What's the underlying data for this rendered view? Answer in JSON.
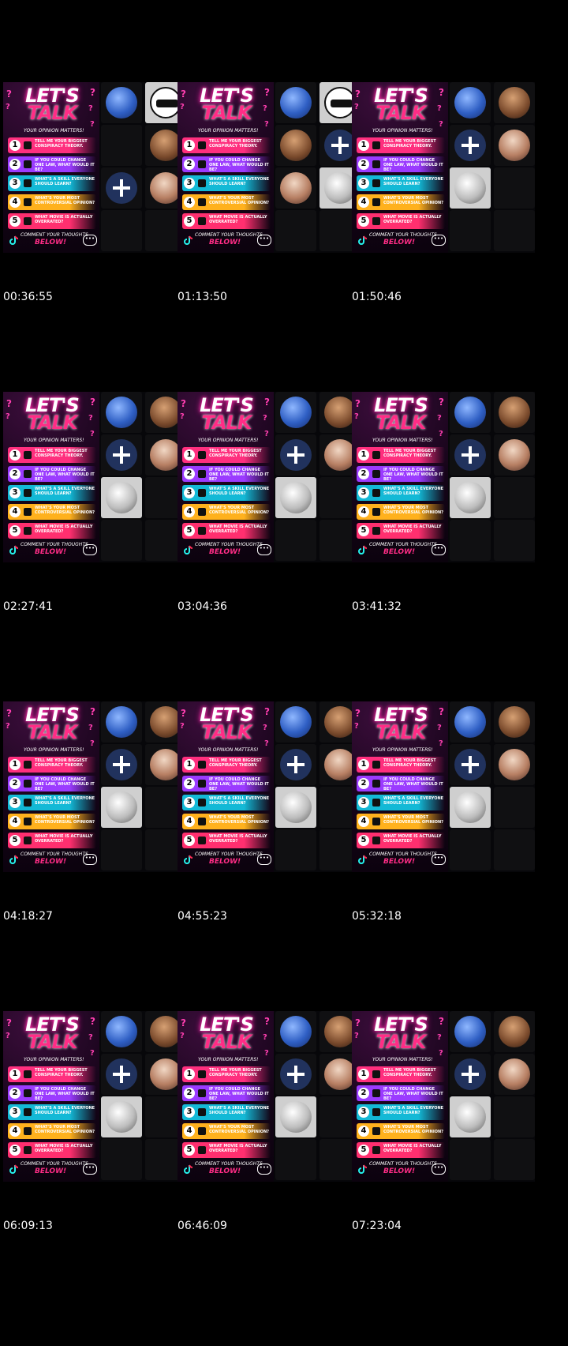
{
  "poster": {
    "title_line1": "LET'S",
    "title_line2": "TALK",
    "subtitle": "YOUR OPINION MATTERS!",
    "items": [
      {
        "num": "1",
        "text": "TELL ME YOUR BIGGEST CONSPIRACY THEORY.",
        "color": "#ff2f7e"
      },
      {
        "num": "2",
        "text": "IF YOU COULD CHANGE ONE LAW, WHAT WOULD IT BE?",
        "color": "#9b3bff"
      },
      {
        "num": "3",
        "text": "WHAT'S A SKILL EVERYONE SHOULD LEARN?",
        "color": "#13b9d6"
      },
      {
        "num": "4",
        "text": "WHAT'S YOUR MOST CONTROVERSIAL OPINION?",
        "color": "#ffb11d"
      },
      {
        "num": "5",
        "text": "WHAT MOVIE IS ACTUALLY OVERRATED?",
        "color": "#ff2f6f"
      }
    ],
    "comment": "COMMENT YOUR THOUGHTS",
    "below": "BELOW!"
  },
  "frames": [
    {
      "timestamp": "00:36:55",
      "layout": "a"
    },
    {
      "timestamp": "01:13:50",
      "layout": "b"
    },
    {
      "timestamp": "01:50:46",
      "layout": "c"
    },
    {
      "timestamp": "02:27:41",
      "layout": "c"
    },
    {
      "timestamp": "03:04:36",
      "layout": "c"
    },
    {
      "timestamp": "03:41:32",
      "layout": "c"
    },
    {
      "timestamp": "04:18:27",
      "layout": "c"
    },
    {
      "timestamp": "04:55:23",
      "layout": "c"
    },
    {
      "timestamp": "05:32:18",
      "layout": "c"
    },
    {
      "timestamp": "06:09:13",
      "layout": "c"
    },
    {
      "timestamp": "06:46:09",
      "layout": "c"
    },
    {
      "timestamp": "07:23:04",
      "layout": "c"
    }
  ],
  "icons": {
    "plus": "plus-icon",
    "tiktok": "tiktok-icon",
    "chat": "chat-bubble-icon"
  }
}
